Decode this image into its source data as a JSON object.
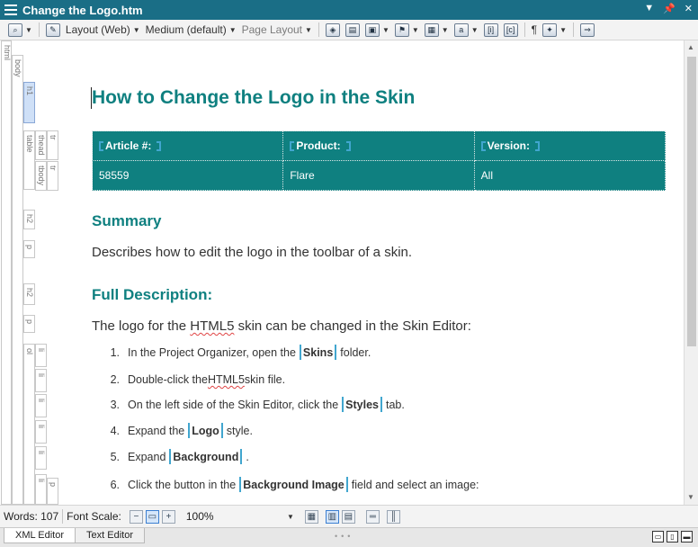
{
  "window": {
    "title": "Change the Logo.htm"
  },
  "toolbar": {
    "layout_label": "Layout (Web)",
    "medium_label": "Medium (default)",
    "page_layout_label": "Page Layout",
    "pilcrow": "¶"
  },
  "structure": {
    "labels": [
      "html",
      "body",
      "h1",
      "table",
      "thead",
      "tr",
      "tbody",
      "tr",
      "h2",
      "p",
      "h2",
      "p",
      "ol",
      "li",
      "li",
      "li",
      "li",
      "li",
      "li",
      "p"
    ]
  },
  "document": {
    "h1": "How to Change the Logo in the Skin",
    "table": {
      "headers": [
        "Article #:",
        "Product:",
        "Version:"
      ],
      "row": [
        "58559",
        "Flare",
        "All"
      ]
    },
    "summary_heading": "Summary",
    "summary_text": "Describes how to edit the logo in the toolbar of a skin.",
    "full_heading": "Full Description:",
    "intro": {
      "before": "The logo for the ",
      "misspelled": "HTML5",
      "after": " skin can be changed in the Skin Editor:"
    },
    "steps": [
      {
        "num": "1.",
        "before": "In the Project Organizer, open the",
        "tag": "Skins",
        "after": "folder."
      },
      {
        "num": "2.",
        "before": "Double-click the ",
        "misspelled": "HTML5",
        "after": " skin file."
      },
      {
        "num": "3.",
        "before": "On the left side of the Skin Editor, click the",
        "tag": "Styles",
        "after": "tab."
      },
      {
        "num": "4.",
        "before": "Expand the",
        "tag": "Logo",
        "after": "style."
      },
      {
        "num": "5.",
        "before": "Expand",
        "tag": "Background",
        "after": "."
      },
      {
        "num": "6.",
        "before": "Click the button in the",
        "tag": "Background Image",
        "after": "field and select an image:"
      }
    ]
  },
  "status": {
    "words_label": "Words: 107",
    "font_scale_label": "Font Scale:",
    "zoom": "100%"
  },
  "tabs": [
    "XML Editor",
    "Text Editor"
  ],
  "colors": {
    "accent": "#1a6e86",
    "heading": "#0f8080",
    "tag_bracket": "#41a6cf"
  }
}
